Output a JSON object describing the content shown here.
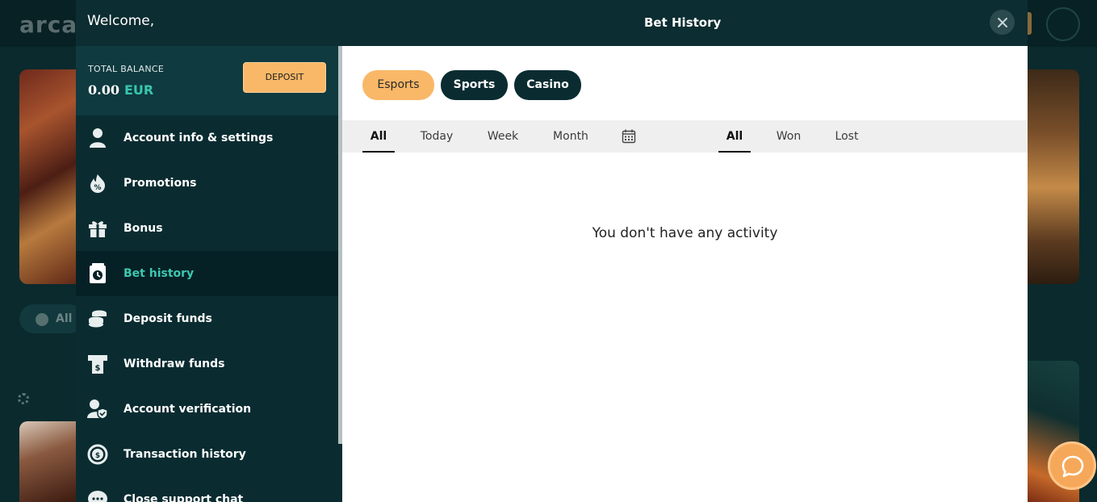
{
  "background": {
    "logo_text": "arca",
    "chip_label": "All I"
  },
  "modal": {
    "welcome": "Welcome,",
    "title": "Bet History"
  },
  "balance": {
    "label": "TOTAL BALANCE",
    "amount": "0.00",
    "currency": "EUR",
    "deposit_label": "DEPOSIT"
  },
  "sidebar": {
    "items": [
      {
        "label": "Account info & settings",
        "icon": "user-icon",
        "active": false
      },
      {
        "label": "Promotions",
        "icon": "promotions-icon",
        "active": false
      },
      {
        "label": "Bonus",
        "icon": "gift-icon",
        "active": false
      },
      {
        "label": "Bet history",
        "icon": "bet-history-icon",
        "active": true
      },
      {
        "label": "Deposit funds",
        "icon": "coins-icon",
        "active": false
      },
      {
        "label": "Withdraw funds",
        "icon": "withdraw-icon",
        "active": false
      },
      {
        "label": "Account verification",
        "icon": "verified-user-icon",
        "active": false
      },
      {
        "label": "Transaction history",
        "icon": "transaction-icon",
        "active": false
      },
      {
        "label": "Close support chat",
        "icon": "chat-icon",
        "active": false
      }
    ]
  },
  "categories": {
    "esports": "Esports",
    "sports": "Sports",
    "casino": "Casino",
    "selected": "Esports"
  },
  "period_filters": {
    "all": "All",
    "today": "Today",
    "week": "Week",
    "month": "Month",
    "selected": "All"
  },
  "result_filters": {
    "all": "All",
    "won": "Won",
    "lost": "Lost",
    "selected": "All"
  },
  "empty_message": "You don't have any activity",
  "colors": {
    "accent_orange": "#f9b868",
    "accent_teal": "#3cc8b0",
    "sidebar_bg": "#0a2c31"
  }
}
